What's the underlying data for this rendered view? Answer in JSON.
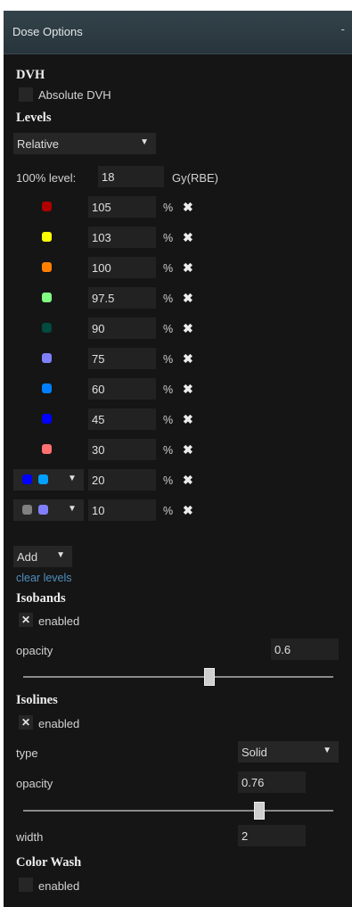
{
  "header": {
    "title": "Dose Options",
    "collapse_icon": "-"
  },
  "dvh": {
    "title": "DVH",
    "absolute_label": "Absolute DVH"
  },
  "levels": {
    "title": "Levels",
    "mode": "Relative",
    "ref_label": "100% level:",
    "ref_value": "18",
    "ref_unit": "Gy(RBE)",
    "unit": "%",
    "items": [
      {
        "value": "105",
        "color": "#b00000"
      },
      {
        "value": "103",
        "color": "#ffff00"
      },
      {
        "value": "100",
        "color": "#ff8000"
      },
      {
        "value": "97.5",
        "color": "#80ff80"
      },
      {
        "value": "90",
        "color": "#004a40"
      },
      {
        "value": "75",
        "color": "#8080ff"
      },
      {
        "value": "60",
        "color": "#0080ff"
      },
      {
        "value": "45",
        "color": "#0000ff"
      },
      {
        "value": "30",
        "color": "#ff7070"
      }
    ],
    "multi_items": [
      {
        "value": "20",
        "colors": [
          "#0000ff",
          "#00a0ff"
        ]
      },
      {
        "value": "10",
        "colors": [
          "#808080",
          "#8080ff"
        ]
      }
    ],
    "add_label": "Add",
    "clear_label": "clear levels"
  },
  "isobands": {
    "title": "Isobands",
    "enabled_label": "enabled",
    "opacity_label": "opacity",
    "opacity_value": "0.6"
  },
  "isolines": {
    "title": "Isolines",
    "enabled_label": "enabled",
    "type_label": "type",
    "type_value": "Solid",
    "opacity_label": "opacity",
    "opacity_value": "0.76",
    "width_label": "width",
    "width_value": "2"
  },
  "color_wash": {
    "title": "Color Wash",
    "enabled_label": "enabled"
  },
  "colors": {
    "panel_bg": "#151515",
    "header_bg": "#2e3c43",
    "link": "#4f8fbf"
  }
}
